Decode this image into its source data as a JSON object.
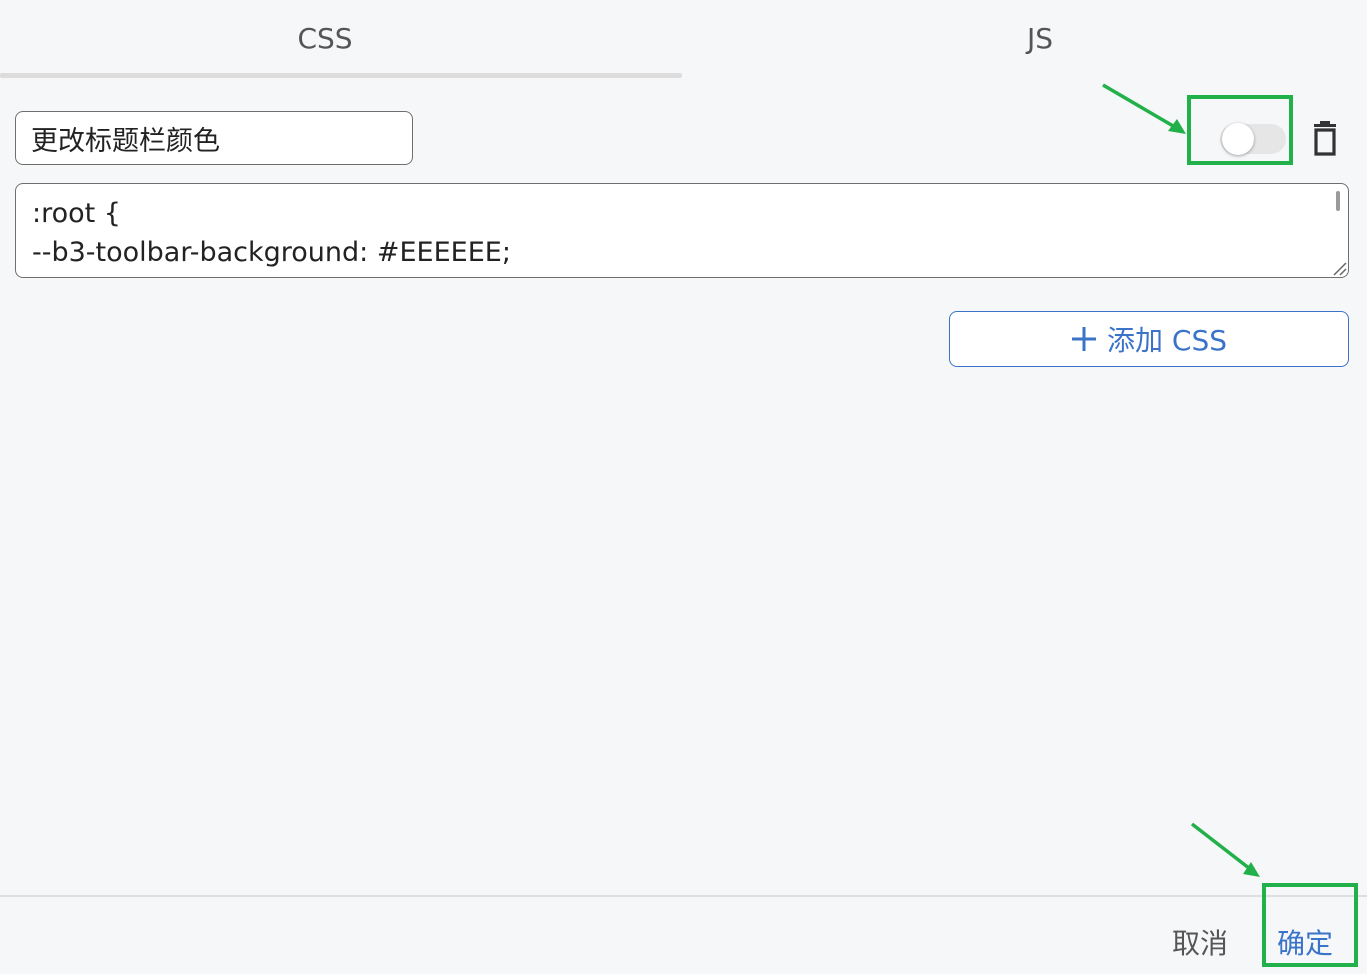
{
  "tabs": [
    {
      "label": "CSS",
      "active": true
    },
    {
      "label": "JS",
      "active": false
    }
  ],
  "snippet": {
    "name": "更改标题栏颜色",
    "enabled": false,
    "code_lines": [
      ":root {",
      "--b3-toolbar-background: #EEEEEE;"
    ]
  },
  "toolbar": {
    "add_label": "添加 CSS"
  },
  "footer": {
    "cancel_label": "取消",
    "confirm_label": "确定"
  },
  "icons": {
    "toggle": "toggle-switch-icon",
    "delete": "trash-icon",
    "add": "plus-icon"
  },
  "colors": {
    "accent": "#3a73c8",
    "annotation": "#22b04a",
    "background": "#f6f7f9"
  }
}
